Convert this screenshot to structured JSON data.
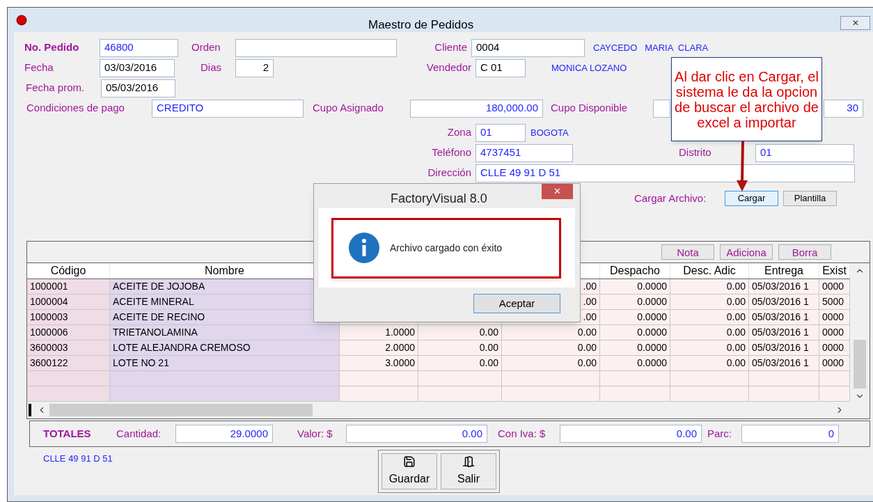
{
  "window": {
    "title": "Maestro de Pedidos",
    "close": "✕"
  },
  "header": {
    "no_pedido": {
      "label": "No. Pedido",
      "value": "46800"
    },
    "orden": {
      "label": "Orden"
    },
    "cliente": {
      "label": "Cliente",
      "value": "0004",
      "name": "CAYCEDO   MARIA  CLARA"
    },
    "fecha": {
      "label": "Fecha",
      "value": "03/03/2016"
    },
    "dias": {
      "label": "Dias",
      "value": "2"
    },
    "vendedor": {
      "label": "Vendedor",
      "value": "C 01",
      "name": "MONICA LOZANO"
    },
    "fecha_prom": {
      "label": "Fecha prom.",
      "value": "05/03/2016"
    },
    "condiciones": {
      "label": "Condiciones de pago",
      "value": "CREDITO"
    },
    "cupo_asignado": {
      "label": "Cupo Asignado",
      "value": "180,000.00"
    },
    "cupo_disponible": {
      "label": "Cupo Disponible"
    },
    "field_right": {
      "value": "30"
    },
    "zona": {
      "label": "Zona",
      "value": "01",
      "name": "BOGOTA"
    },
    "telefono": {
      "label": "Teléfono",
      "value": "4737451"
    },
    "distrito": {
      "label": "Distrito",
      "value": "01"
    },
    "direccion": {
      "label": "Dirección",
      "value": "CLLE 49 91 D 51"
    },
    "cargar_archivo": {
      "label": "Cargar Archivo:",
      "buttons": [
        "Cargar",
        "Plantilla"
      ]
    }
  },
  "grid": {
    "buttons": [
      "Nota",
      "Adiciona",
      "Borra"
    ],
    "columns": {
      "codigo": "Código",
      "nombre": "Nombre",
      "despacho": "Despacho",
      "desc_adic": "Desc. Adic",
      "entrega": "Entrega",
      "exist": "Exist"
    },
    "rows": [
      {
        "codigo": "1000001",
        "nombre": "ACEITE DE JOJOBA",
        "column_5": ".00",
        "despacho": "0.0000",
        "desc_adic": "0.00",
        "entrega": "05/03/2016 1",
        "exist": "0000"
      },
      {
        "codigo": "1000004",
        "nombre": "ACEITE MINERAL",
        "column_5": ".00",
        "despacho": "0.0000",
        "desc_adic": "0.00",
        "entrega": "05/03/2016 1",
        "exist": "5000"
      },
      {
        "codigo": "1000003",
        "nombre": "ACEITE DE RECINO",
        "column_5": ".00",
        "despacho": "0.0000",
        "desc_adic": "0.00",
        "entrega": "05/03/2016 1",
        "exist": "0000"
      },
      {
        "codigo": "1000006",
        "nombre": "TRIETANOLAMINA",
        "column_3": "1.0000",
        "column_4": "0.00",
        "column_5": "0.00",
        "despacho": "0.0000",
        "desc_adic": "0.00",
        "entrega": "05/03/2016 1",
        "exist": "0000"
      },
      {
        "codigo": "3600003",
        "nombre": "LOTE ALEJANDRA CREMOSO",
        "column_3": "2.0000",
        "column_4": "0.00",
        "column_5": "0.00",
        "despacho": "0.0000",
        "desc_adic": "0.00",
        "entrega": "05/03/2016 1",
        "exist": "0000"
      },
      {
        "codigo": "3600122",
        "nombre": "LOTE NO 21",
        "column_3": "3.0000",
        "column_4": "0.00",
        "column_5": "0.00",
        "despacho": "0.0000",
        "desc_adic": "0.00",
        "entrega": "05/03/2016 1",
        "exist": "0000"
      }
    ]
  },
  "totals": {
    "title": "TOTALES",
    "cantidad": {
      "label": "Cantidad:",
      "value": "29.0000"
    },
    "valor": {
      "label": "Valor: $",
      "value": "0.00"
    },
    "con_iva": {
      "label": "Con Iva: $",
      "value": "0.00"
    },
    "parc": {
      "label": "Parc:",
      "value": "0"
    }
  },
  "footer_address": "CLLE 49 91 D 51",
  "actions": [
    "Guardar",
    "Salir"
  ],
  "dialog": {
    "title": "FactoryVisual 8.0",
    "close": "✕",
    "message": "Archivo cargado con éxito",
    "button": "Aceptar"
  },
  "callout": {
    "text": "Al dar clic en Cargar, el sistema le da la opcion de buscar el archivo de excel a importar"
  }
}
